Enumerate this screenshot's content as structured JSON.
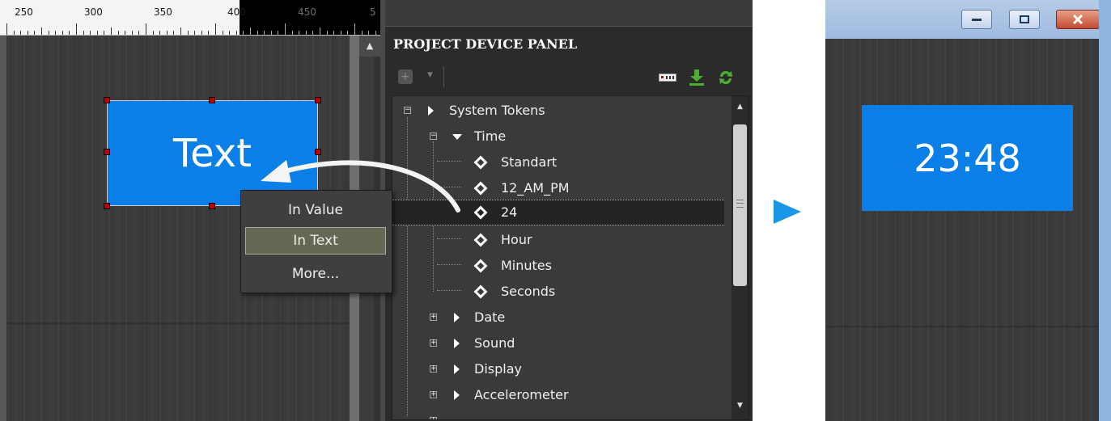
{
  "editor": {
    "ruler": {
      "labels": [
        "250",
        "300",
        "350",
        "400",
        "450",
        "5"
      ]
    },
    "widget_text": "Text",
    "context_menu": {
      "items": [
        "In Value",
        "In Text",
        "More..."
      ],
      "active_index": 1
    }
  },
  "panel": {
    "title": "PROJECT DEVICE PANEL",
    "toolbar_icons": [
      "add-icon",
      "keyboard-icon",
      "download-icon",
      "refresh-icon"
    ],
    "tree": {
      "root": "System Tokens",
      "time_group": "Time",
      "time_items": [
        "Standart",
        "12_AM_PM",
        "24",
        "Hour",
        "Minutes",
        "Seconds"
      ],
      "selected_item": "24",
      "groups": [
        "Date",
        "Sound",
        "Display",
        "Accelerometer"
      ]
    }
  },
  "result": {
    "clock_text": "23:48"
  },
  "colors": {
    "widget_blue": "#0a7fe8",
    "arrow_blue": "#1996e6",
    "panel_bg": "#2b2b2b"
  }
}
